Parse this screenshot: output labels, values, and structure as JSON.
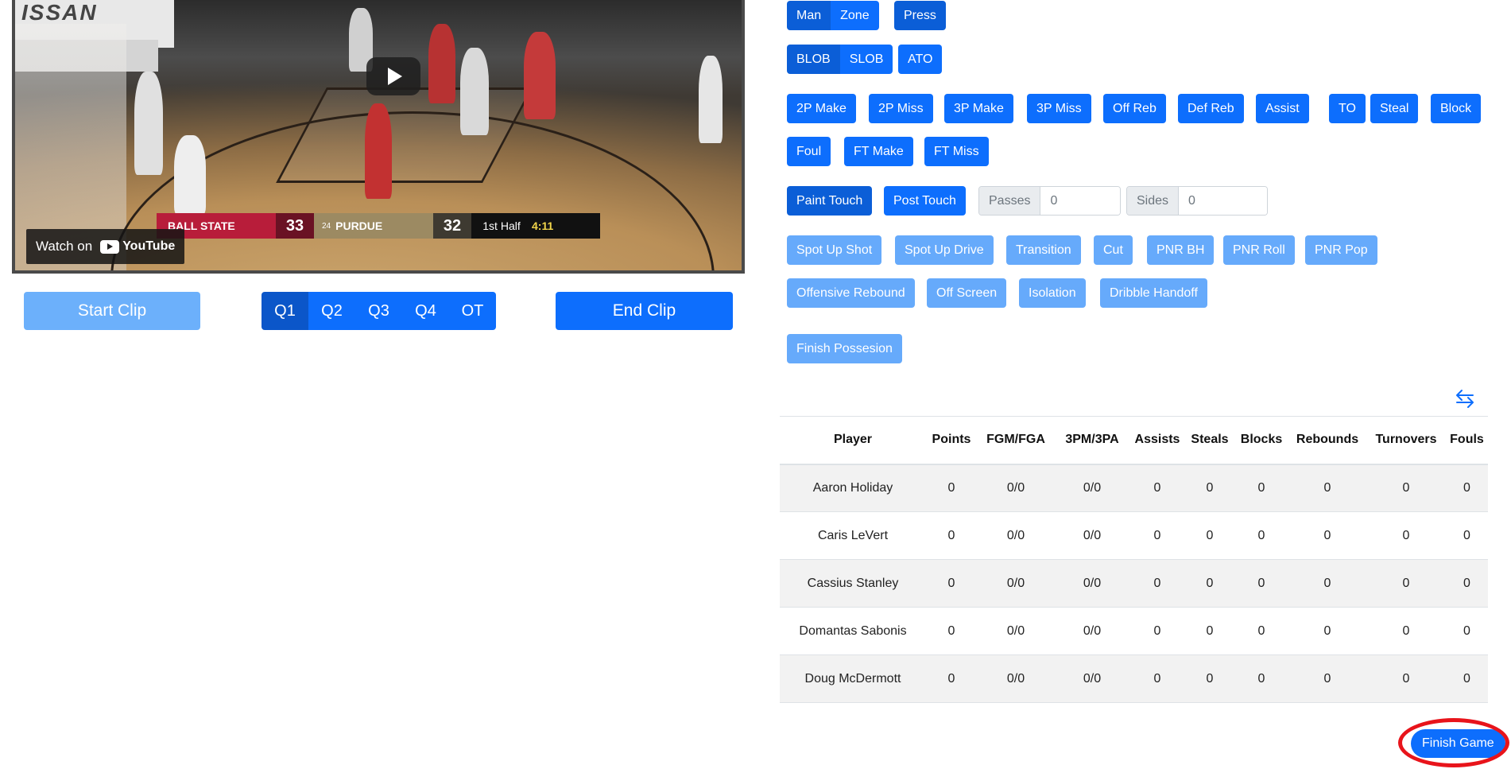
{
  "video": {
    "watch_label": "Watch on",
    "youtube_label": "YouTube",
    "arena_text": "ISSAN",
    "scorebug": {
      "team1": "BALL STATE",
      "score1": "33",
      "team2_rank": "24",
      "team2": "PURDUE",
      "score2": "32",
      "period": "1st Half",
      "clock": "4:11"
    }
  },
  "clip": {
    "start_label": "Start Clip",
    "end_label": "End Clip",
    "quarters": [
      "Q1",
      "Q2",
      "Q3",
      "Q4",
      "OT"
    ],
    "active_quarter": "Q1"
  },
  "defense": {
    "man": "Man",
    "zone": "Zone",
    "press": "Press"
  },
  "inbound": {
    "blob": "BLOB",
    "slob": "SLOB",
    "ato": "ATO"
  },
  "stat_buttons": {
    "row1": [
      "2P Make",
      "2P Miss",
      "3P Make",
      "3P Miss",
      "Off Reb",
      "Def Reb",
      "Assist",
      "TO",
      "Steal",
      "Block"
    ],
    "row2": [
      "Foul",
      "FT Make",
      "FT Miss"
    ]
  },
  "touches": {
    "paint": "Paint Touch",
    "post": "Post Touch",
    "passes_label": "Passes",
    "passes_value": "0",
    "sides_label": "Sides",
    "sides_value": "0"
  },
  "play_types": {
    "row1": [
      "Spot Up Shot",
      "Spot Up Drive",
      "Transition",
      "Cut",
      "PNR BH",
      "PNR Roll",
      "PNR Pop"
    ],
    "row2": [
      "Offensive Rebound",
      "Off Screen",
      "Isolation",
      "Dribble Handoff"
    ]
  },
  "finish_possession": "Finish Possesion",
  "table": {
    "headers": [
      "Player",
      "Points",
      "FGM/FGA",
      "3PM/3PA",
      "Assists",
      "Steals",
      "Blocks",
      "Rebounds",
      "Turnovers",
      "Fouls"
    ],
    "rows": [
      [
        "Aaron Holiday",
        "0",
        "0/0",
        "0/0",
        "0",
        "0",
        "0",
        "0",
        "0",
        "0"
      ],
      [
        "Caris LeVert",
        "0",
        "0/0",
        "0/0",
        "0",
        "0",
        "0",
        "0",
        "0",
        "0"
      ],
      [
        "Cassius Stanley",
        "0",
        "0/0",
        "0/0",
        "0",
        "0",
        "0",
        "0",
        "0",
        "0"
      ],
      [
        "Domantas Sabonis",
        "0",
        "0/0",
        "0/0",
        "0",
        "0",
        "0",
        "0",
        "0",
        "0"
      ],
      [
        "Doug McDermott",
        "0",
        "0/0",
        "0/0",
        "0",
        "0",
        "0",
        "0",
        "0",
        "0"
      ]
    ]
  },
  "finish_game": "Finish Game",
  "colors": {
    "primary": "#0d6efd",
    "primary_active": "#0b5ed7",
    "primary_light": "#66aafb",
    "highlight": "#e8141b"
  },
  "icons": {
    "swap": "swap-arrows-icon",
    "play": "play-icon",
    "youtube": "youtube-logo-icon"
  }
}
